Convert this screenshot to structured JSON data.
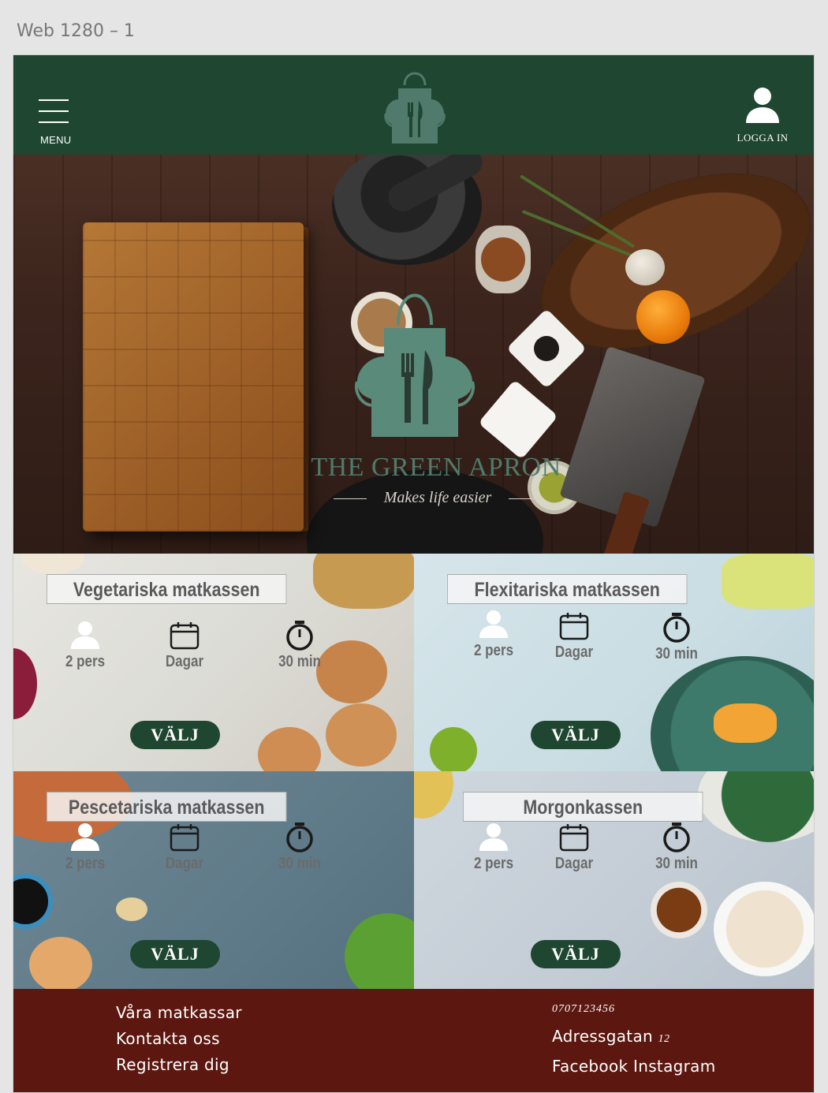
{
  "artboard": {
    "label": "Web 1280 – 1"
  },
  "header": {
    "menu_label": "MENU",
    "login_label": "LOGGA IN",
    "bg_color": "#1e4631"
  },
  "hero": {
    "title": "THE GREEN APRON",
    "tagline": "Makes life easier"
  },
  "cards": [
    {
      "title": "Vegetariska matkassen",
      "persons": "2 pers",
      "days": "Dagar",
      "time": "30 min",
      "button": "VÄLJ"
    },
    {
      "title": "Flexitariska matkassen",
      "persons": "2 pers",
      "days": "Dagar",
      "time": "30 min",
      "button": "VÄLJ"
    },
    {
      "title": "Pescetariska matkassen",
      "persons": "2 pers",
      "days": "Dagar",
      "time": "30 min",
      "button": "VÄLJ"
    },
    {
      "title": "Morgonkassen",
      "persons": "2 pers",
      "days": "Dagar",
      "time": "30 min",
      "button": "VÄLJ"
    }
  ],
  "footer": {
    "links": [
      "Våra matkassar",
      "Kontakta oss",
      "Registrera dig"
    ],
    "phone": "0707123456",
    "address": "Adressgatan",
    "address_number": "12",
    "social": "Facebook Instagram",
    "bg_color": "#5c1810"
  },
  "icons": {
    "menu": "hamburger-icon",
    "logo": "apron-icon",
    "login": "user-icon",
    "persons": "person-icon",
    "days": "calendar-icon",
    "time": "stopwatch-icon"
  }
}
